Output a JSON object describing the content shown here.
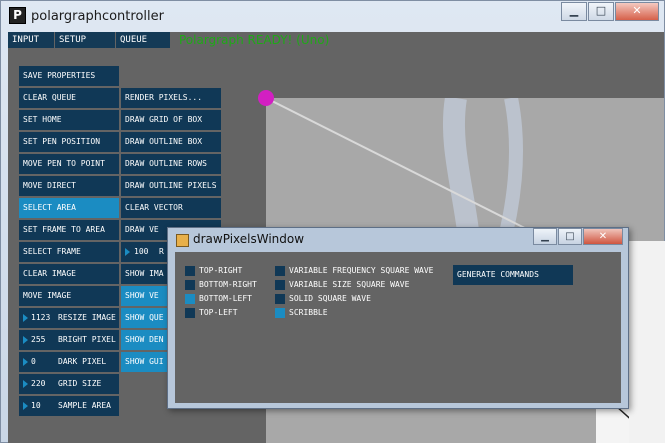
{
  "window": {
    "title": "polargraphcontroller",
    "app_icon": "P"
  },
  "tabs": [
    {
      "label": "INPUT",
      "active": true
    },
    {
      "label": "SETUP",
      "active": false
    },
    {
      "label": "QUEUE",
      "active": false
    }
  ],
  "status_text": "Polargraph READY! (Uno)",
  "colors": {
    "panel": "#646464",
    "button": "#103856",
    "active": "#1b8cc2",
    "status": "#1fa818",
    "pen": "#d21fc2"
  },
  "left_buttons": [
    {
      "label": "SAVE PROPERTIES"
    },
    {
      "label": "CLEAR QUEUE"
    },
    {
      "label": "SET HOME"
    },
    {
      "label": "SET PEN POSITION"
    },
    {
      "label": "MOVE PEN TO POINT"
    },
    {
      "label": "MOVE DIRECT"
    },
    {
      "label": "SELECT AREA",
      "active": true
    },
    {
      "label": "SET FRAME TO AREA"
    },
    {
      "label": "SELECT FRAME"
    },
    {
      "label": "CLEAR IMAGE"
    },
    {
      "label": "MOVE IMAGE"
    },
    {
      "label": "RESIZE IMAGE",
      "value": "1123"
    },
    {
      "label": "BRIGHT PIXEL",
      "value": "255"
    },
    {
      "label": "DARK PIXEL",
      "value": "0"
    },
    {
      "label": "GRID SIZE",
      "value": "220"
    },
    {
      "label": "SAMPLE AREA",
      "value": "10"
    }
  ],
  "right_buttons": [
    {
      "label": "RENDER PIXELS..."
    },
    {
      "label": "DRAW GRID OF BOX"
    },
    {
      "label": "DRAW OUTLINE BOX"
    },
    {
      "label": "DRAW OUTLINE ROWS"
    },
    {
      "label": "DRAW OUTLINE PIXELS"
    },
    {
      "label": "CLEAR VECTOR"
    },
    {
      "label": "DRAW VE"
    },
    {
      "label": "R",
      "value": "100"
    },
    {
      "label": "SHOW IMA"
    },
    {
      "label": "SHOW VE"
    },
    {
      "label": "SHOW QUE"
    },
    {
      "label": "SHOW DEN"
    },
    {
      "label": "SHOW GUI"
    }
  ],
  "dialog": {
    "title": "drawPixelsWindow",
    "start_corner_options": [
      {
        "label": "TOP-RIGHT",
        "selected": false
      },
      {
        "label": "BOTTOM-RIGHT",
        "selected": false
      },
      {
        "label": "BOTTOM-LEFT",
        "selected": true
      },
      {
        "label": "TOP-LEFT",
        "selected": false
      }
    ],
    "style_options": [
      {
        "label": "VARIABLE FREQUENCY SQUARE WAVE",
        "selected": false
      },
      {
        "label": "VARIABLE SIZE SQUARE WAVE",
        "selected": false
      },
      {
        "label": "SOLID SQUARE WAVE",
        "selected": false
      },
      {
        "label": "SCRIBBLE",
        "selected": true
      }
    ],
    "generate_label": "GENERATE COMMANDS"
  }
}
